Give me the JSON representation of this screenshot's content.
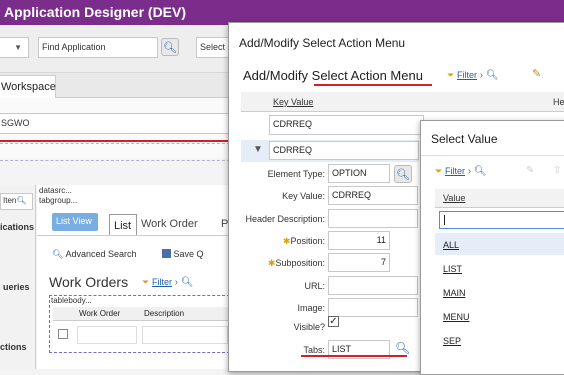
{
  "app_title": "Application Designer (DEV)",
  "toolbar": {
    "find_application": "Find Application",
    "select_label": "Select"
  },
  "workspace_tab": "Workspace",
  "workspace_field": "SGWO",
  "sidebar": {
    "item_search": "Iten",
    "applications": "ications",
    "queries": "ueries",
    "actions": "ctions"
  },
  "canvas": {
    "datasrc": "datasrc...",
    "tabgroup": "tabgroup...",
    "list_view": "List View",
    "tab_list": "List",
    "tab_work_order": "Work Order",
    "tab_partial": "P",
    "advanced_search": "Advanced Search",
    "save_query": "Save Q",
    "section_title": "Work Orders",
    "filter": "Filter",
    "tablebody": "tablebody...",
    "col_work_order": "Work Order",
    "col_description": "Description"
  },
  "dialog1": {
    "window_title": "Add/Modify Select Action Menu",
    "header_prefix": "Add/Modify ",
    "header_emph": "Select Action Menu",
    "filter": "Filter",
    "col_key_value": "Key Value",
    "col_he": "He",
    "row1_key": "CDRREQ",
    "row2_key": "CDRREQ",
    "labels": {
      "element_type": "Element Type:",
      "key_value": "Key Value:",
      "header_description": "Header Description:",
      "position": "Position:",
      "subposition": "Subposition:",
      "url": "URL:",
      "image": "Image:",
      "visible": "Visible?",
      "tabs": "Tabs:"
    },
    "values": {
      "element_type": "OPTION",
      "key_value": "CDRREQ",
      "header_description": "",
      "position": "11",
      "subposition": "7",
      "url": "",
      "image": "",
      "tabs": "LIST"
    },
    "visible_checked": true
  },
  "dialog2": {
    "title": "Select Value",
    "filter": "Filter",
    "col_value": "Value",
    "search_value": "",
    "items": [
      "ALL",
      "LIST",
      "MAIN",
      "MENU",
      "SEP"
    ]
  },
  "colors": {
    "title_bar": "#7b2d8b",
    "link": "#1f5fae",
    "accent_red": "#d0202a",
    "selected_row": "#e5eef8",
    "list_view_badge": "#7aaee0"
  }
}
